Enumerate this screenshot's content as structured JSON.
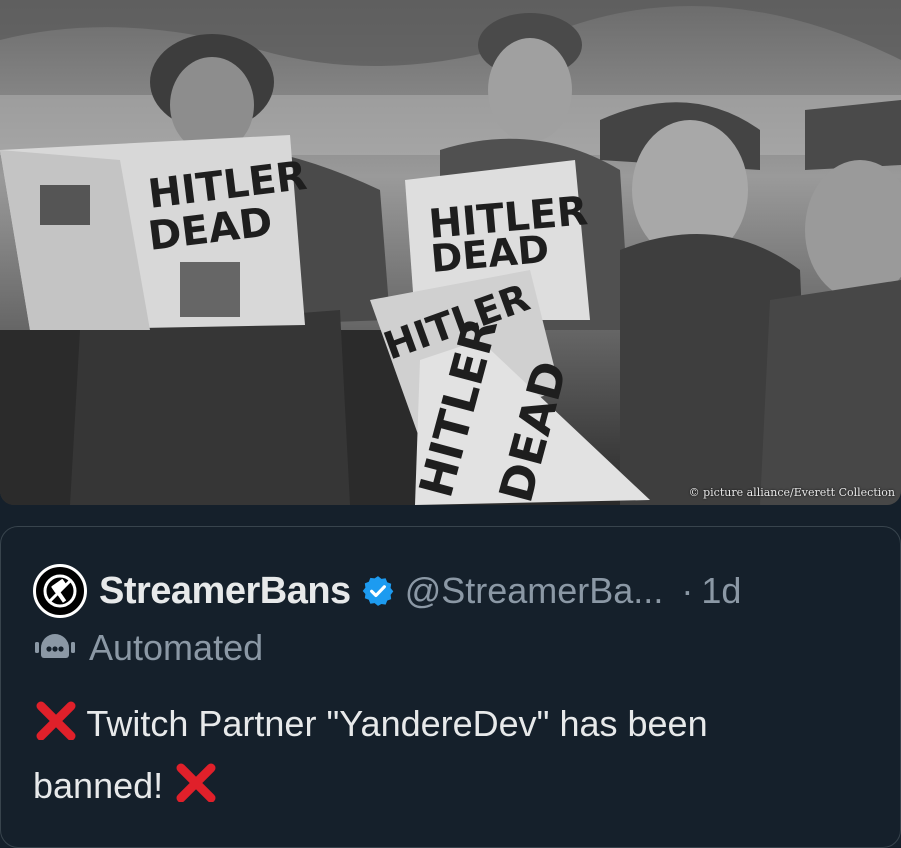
{
  "photo": {
    "headline_line1": "HITLER",
    "headline_line2": "DEAD",
    "credit": "© picture alliance/Everett Collection",
    "icon": "newspaper-photo"
  },
  "tweet": {
    "display_name": "StreamerBans",
    "handle": "@StreamerBa...",
    "separator": "·",
    "time": "1d",
    "label": "Automated",
    "text_part1": "Twitch Partner \"YandereDev\" has been",
    "text_part2": "banned!",
    "emoji": "cross-mark",
    "verified_color": "#1d9bf0",
    "cross_color": "#e0202a"
  }
}
